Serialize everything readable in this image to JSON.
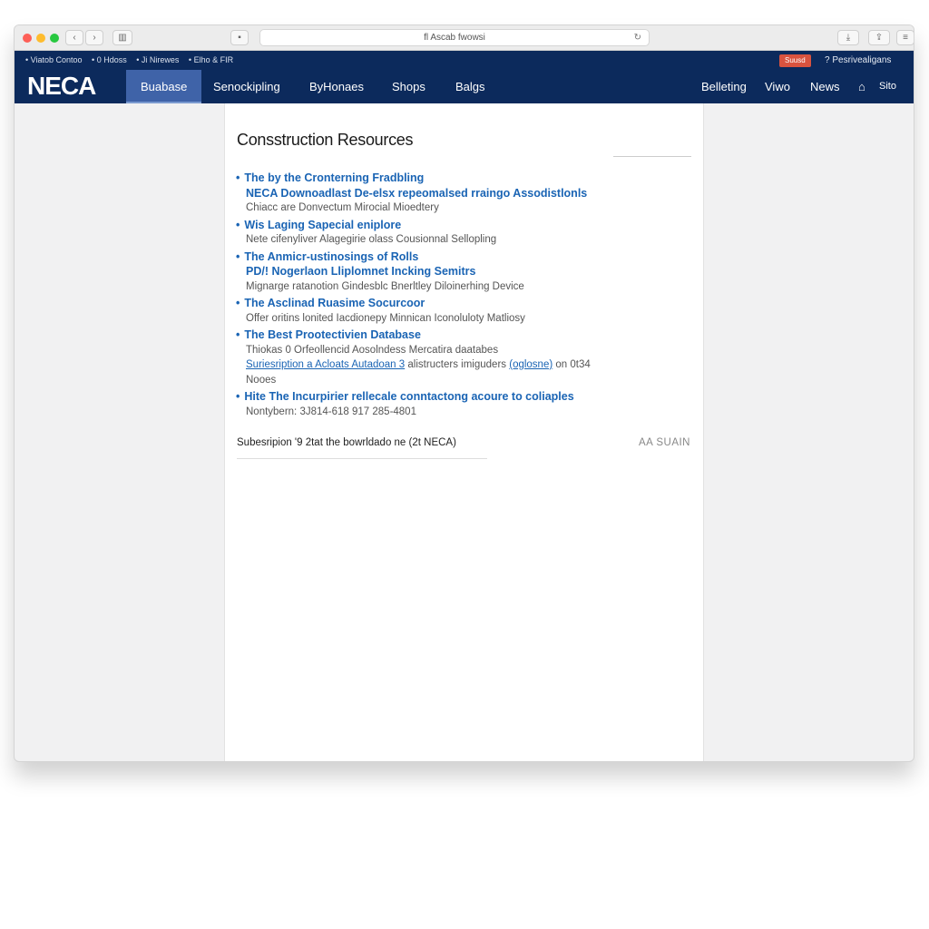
{
  "browser": {
    "url": "fl Ascab fwowsi",
    "back": "‹",
    "forward": "›"
  },
  "header": {
    "top_links": [
      "• Viatob Contoo",
      "• 0 Hdoss",
      "• Ji Nirewes",
      "• Elho & FIR"
    ],
    "subscribe": "Suusd",
    "help": "? Pesrivealigans",
    "logo": "NECA",
    "nav_left": [
      "Buabase",
      "Senockipling",
      "ByHonaes",
      "Shops",
      "Balgs"
    ],
    "nav_right": [
      "Belleting",
      "Viwo",
      "News",
      "Sito"
    ]
  },
  "main": {
    "title": "Consstruction Resources",
    "items": [
      {
        "lines": [
          "The by the Cronterning Fradbling",
          "NECA Downoadlast De-elsx repeomalsed rraingo Assodistlonls"
        ],
        "desc": [
          "Chiacc are Donvectum Mirocial Mioedtery"
        ]
      },
      {
        "lines": [
          "Wis Laging Sapecial eniplore"
        ],
        "desc": [
          "Nete cifenyliver Alagegirie olass Cousionnal Sellopling"
        ]
      },
      {
        "lines": [
          "The Anmicr-ustinosings of Rolls",
          "PD/! Nogerlaon Lliplomnet Incking Semitrs"
        ],
        "desc": [
          "Mignarge ratanotion Gindesblc Bnerltley Diloinerhing Device"
        ]
      },
      {
        "lines": [
          "The Asclinad Ruasime Socurcoor"
        ],
        "desc": [
          "Offer oritins lonited Iacdionepy Minnican Iconoluloty Matliosy"
        ]
      },
      {
        "lines": [
          "The Best Prootectivien Database"
        ],
        "desc": [
          "Thiokas 0 Orfeollencid Aosolndess Mercatira daatabes"
        ],
        "link1": "Suriesription a Acloats Autadoan 3",
        "mid": " alistructers imiguders ",
        "link2": "(oglosne)",
        "tail": " on 0t34",
        "extra": "Nooes"
      },
      {
        "lines": [
          "Hite The Incurpirier rellecale conntactong acoure to coliaples"
        ],
        "desc": [
          "Nontybern: 3J814-618 917 285-4801"
        ]
      }
    ],
    "footer_left": "Subesripion '9 2tat the bowrldado ne (2t NECA)",
    "footer_right": "AA SUAIN"
  },
  "colors": {
    "navy": "#0c2a5c",
    "active": "#3f63a8",
    "link": "#1a64b4",
    "subscribe": "#d9533f"
  }
}
